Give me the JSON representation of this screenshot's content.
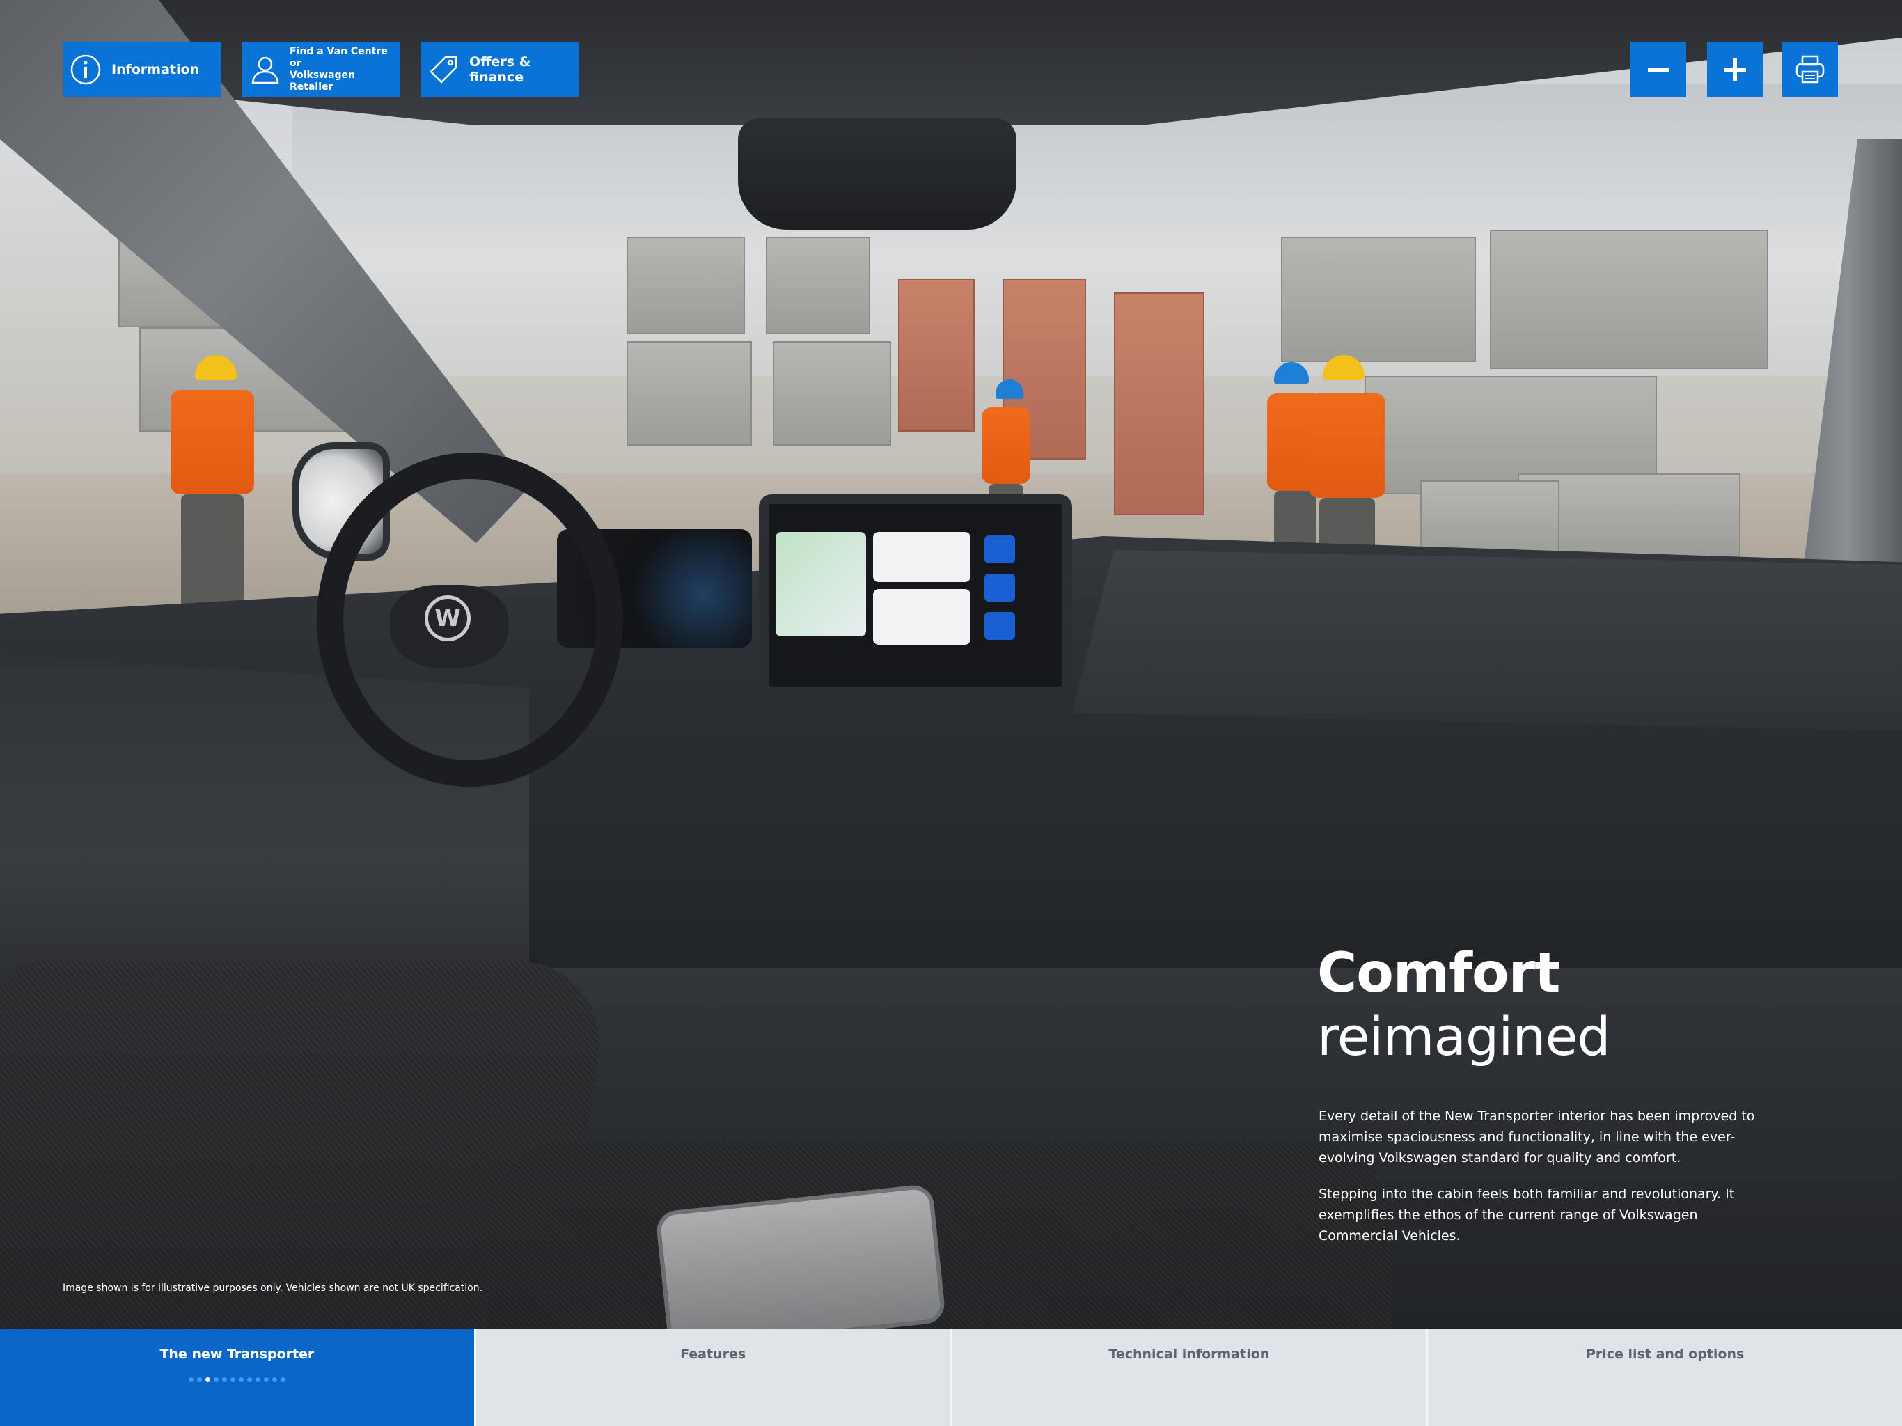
{
  "toolbar": {
    "information_label": "Information",
    "find_label_line1": "Find a Van Centre or",
    "find_label_line2": "Volkswagen Retailer",
    "offers_label": "Offers & finance",
    "icons": {
      "information": "info-icon",
      "find": "person-icon",
      "offers": "tag-icon",
      "zoom_out": "minus-icon",
      "zoom_in": "plus-icon",
      "print": "printer-icon"
    }
  },
  "hero": {
    "title_bold": "Comfort",
    "title_light": "reimagined",
    "paragraph1": "Every detail of the New Transporter interior has been improved to maximise spaciousness and functionality, in line with the ever-evolving Volkswagen standard for quality and comfort.",
    "paragraph2": "Stepping into the cabin feels both familiar and revolutionary. It exemplifies the ethos of the current range of Volkswagen Commercial Vehicles.",
    "disclaimer": "Image shown is for illustrative purposes only. Vehicles shown are not UK specification."
  },
  "bottom_nav": {
    "tabs": [
      {
        "label": "The new Transporter",
        "active": true
      },
      {
        "label": "Features",
        "active": false
      },
      {
        "label": "Technical information",
        "active": false
      },
      {
        "label": "Price list and options",
        "active": false
      }
    ],
    "page_dots_total": 12,
    "page_dots_current": 3
  },
  "colors": {
    "brand_blue": "#0a74d6",
    "active_tab": "#0a67c9",
    "inactive_tab": "#dfe4e8",
    "inactive_tab_text": "#5b6770"
  }
}
